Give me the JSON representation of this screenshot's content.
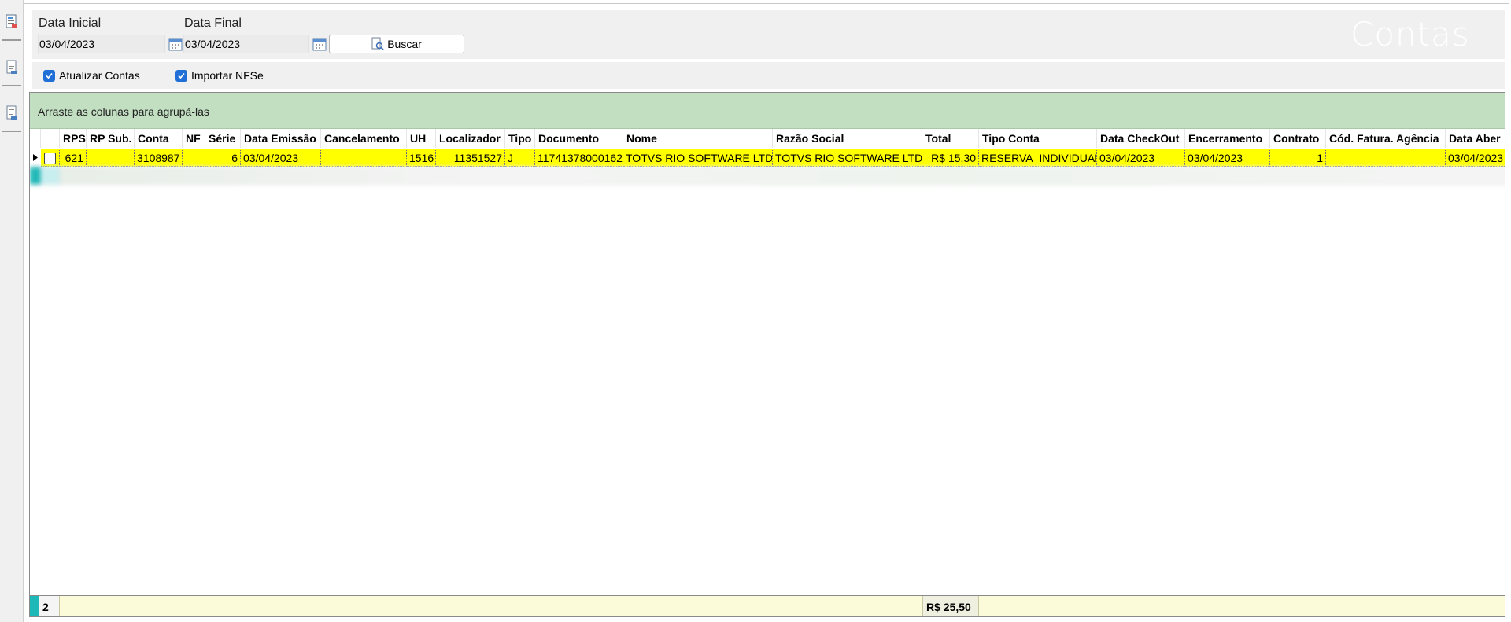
{
  "toolbar": {
    "icons": [
      "report-icon",
      "document-icon",
      "document-icon"
    ]
  },
  "filter": {
    "data_inicial_label": "Data Inicial",
    "data_inicial_value": "03/04/2023",
    "data_final_label": "Data Final",
    "data_final_value": "03/04/2023",
    "buscar_label": "Buscar",
    "title": "Contas"
  },
  "options": {
    "atualizar_label": "Atualizar Contas",
    "atualizar_checked": true,
    "importar_label": "Importar NFSe",
    "importar_checked": true
  },
  "grid": {
    "group_hint": "Arraste as colunas para agrupá-las",
    "columns": [
      "RPS",
      "RP Sub.",
      "Conta",
      "NF",
      "Série",
      "Data Emissão",
      "Cancelamento",
      "UH",
      "Localizador",
      "Tipo",
      "Documento",
      "Nome",
      "Razão Social",
      "Total",
      "Tipo Conta",
      "Data CheckOut",
      "Encerramento",
      "Contrato",
      "Cód. Fatura. Agência",
      "Data Aber"
    ],
    "rows": [
      {
        "rps": "621",
        "rp_sub": "",
        "conta": "3108987",
        "nf": "",
        "serie": "6",
        "data_emissao": "03/04/2023",
        "cancelamento": "",
        "uh": "1516",
        "localizador": "11351527",
        "tipo": "J",
        "documento": "11741378000162",
        "nome": "TOTVS RIO SOFTWARE LTDA",
        "razao_social": "TOTVS RIO SOFTWARE LTDA",
        "total": "R$ 15,30",
        "tipo_conta": "RESERVA_INDIVIDUAL",
        "data_checkout": "03/04/2023",
        "encerramento": "03/04/2023",
        "contrato": "1",
        "cod_fatura": "",
        "data_abertura": "03/04/2023"
      }
    ],
    "footer": {
      "count": "2",
      "total": "R$ 25,50"
    },
    "selected_row_color": "#ffff00",
    "group_area_color": "#c2dfc1"
  }
}
